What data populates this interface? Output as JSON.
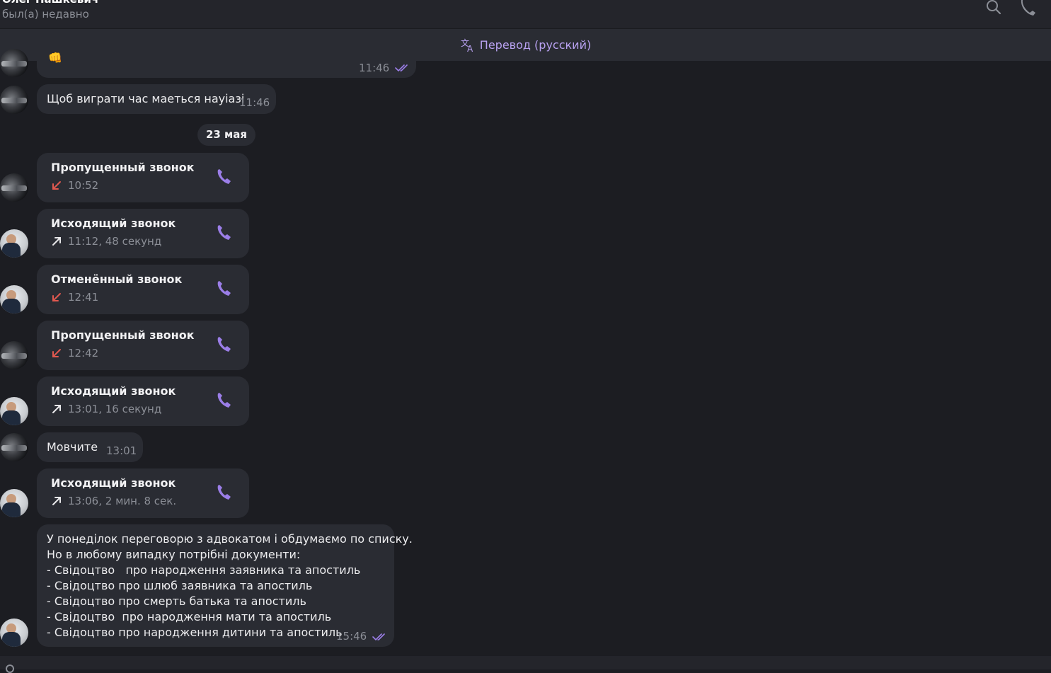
{
  "header": {
    "chat_name": "Олег Пашкевич",
    "status": "был(а) недавно",
    "search_icon": "search-icon",
    "call_icon": "phone-icon"
  },
  "translate_bar": {
    "label": "Перевод (русский)",
    "icon": "translate-icon",
    "accent": "#b9a2f2"
  },
  "colors": {
    "background": "#1c1d22",
    "bubble": "#2a2c33",
    "missed_arrow": "#e0584f",
    "phone_accent": "#9b7ee8"
  },
  "messages": {
    "m1": {
      "time": "11:46",
      "read": true
    },
    "m2": {
      "text": "Щоб виграти час маеться науіазі",
      "time": "11:46"
    },
    "date_separator": "23 мая",
    "call1": {
      "title": "Пропущенный звонок",
      "detail": "10:52",
      "direction": "incoming-missed"
    },
    "call2": {
      "title": "Исходящий звонок",
      "detail": "11:12, 48 секунд",
      "direction": "outgoing"
    },
    "call3": {
      "title": "Отменённый звонок",
      "detail": "12:41",
      "direction": "incoming-missed"
    },
    "call4": {
      "title": "Пропущенный звонок",
      "detail": "12:42",
      "direction": "incoming-missed"
    },
    "call5": {
      "title": "Исходящий звонок",
      "detail": "13:01, 16 секунд",
      "direction": "outgoing"
    },
    "m3": {
      "text": "Мовчите",
      "time": "13:01"
    },
    "call6": {
      "title": "Исходящий звонок",
      "detail": "13:06, 2 мин. 8 сек.",
      "direction": "outgoing"
    },
    "m4": {
      "lines": [
        "У понеділок переговорю з адвокатом і обдумаємо по списку.",
        "Но в любому випадку потрібні документи:",
        "- Свідоцтво   про народження заявника та апостиль",
        "- Свідоцтво про шлюб заявника та апостиль",
        "- Свідоцтво про смерть батька та апостиль",
        "- Свідоцтво  про народження мати та апостиль",
        "- Свідоцтво про народження дитини та апостиль"
      ],
      "time": "15:46",
      "read": true
    }
  }
}
